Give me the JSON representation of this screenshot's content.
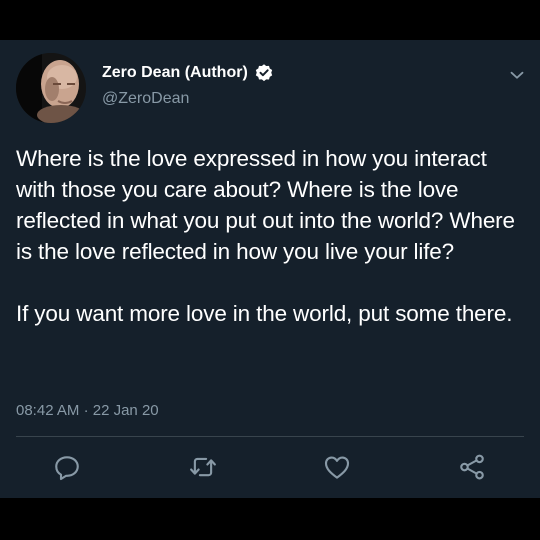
{
  "tweet": {
    "display_name": "Zero Dean (Author)",
    "handle": "@ZeroDean",
    "paragraphs": [
      "Where is the love expressed in how you interact with those you care about? Where is the love reflected in what you put out into the world? Where is the love reflected in how you live your life?",
      "If you want more love in the world, put some there."
    ],
    "time": "08:42 AM",
    "separator": "·",
    "date": "22 Jan 20"
  },
  "icons": {
    "verified": "verified-badge-icon",
    "menu": "chevron-down-icon",
    "reply": "reply-icon",
    "retweet": "retweet-icon",
    "like": "heart-icon",
    "share": "share-icon"
  },
  "colors": {
    "background": "#15202b",
    "text": "#ffffff",
    "secondary_text": "#8899a6",
    "divider": "#38444d",
    "outer_frame": "#000000"
  }
}
